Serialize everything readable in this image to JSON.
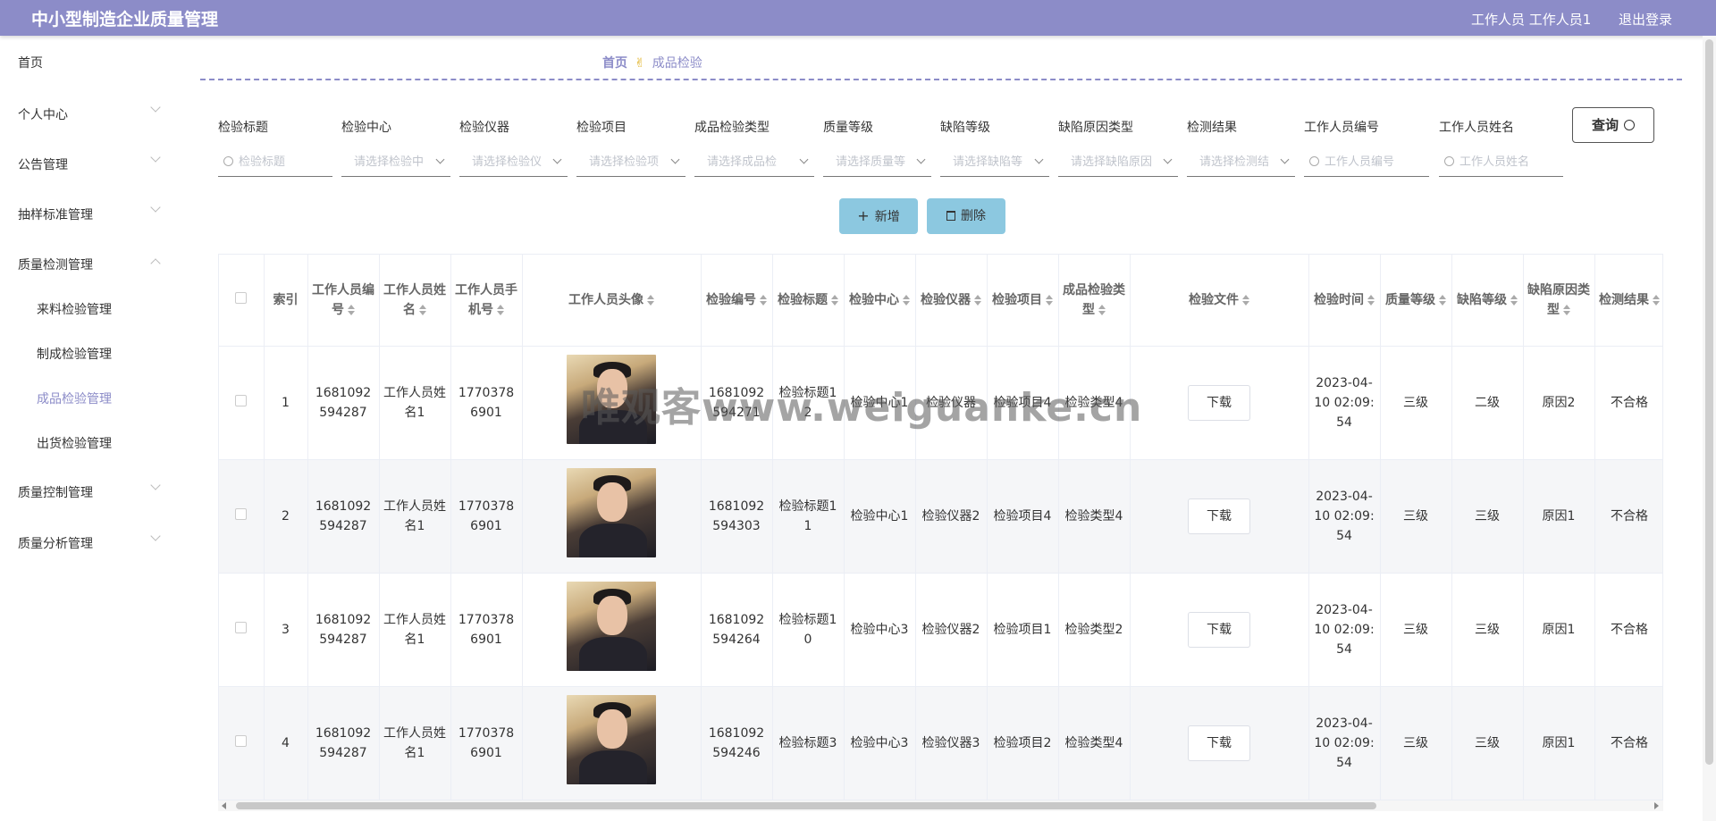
{
  "header": {
    "title": "中小型制造企业质量管理",
    "user": "工作人员 工作人员1",
    "logout": "退出登录"
  },
  "sidebar": {
    "items": [
      {
        "label": "首页"
      },
      {
        "label": "个人中心"
      },
      {
        "label": "公告管理"
      },
      {
        "label": "抽样标准管理"
      },
      {
        "label": "质量检测管理"
      },
      {
        "label": "来料检验管理"
      },
      {
        "label": "制成检验管理"
      },
      {
        "label": "成品检验管理"
      },
      {
        "label": "出货检验管理"
      },
      {
        "label": "质量控制管理"
      },
      {
        "label": "质量分析管理"
      }
    ]
  },
  "breadcrumb": {
    "home": "首页",
    "separator": "✌",
    "current": "成品检验"
  },
  "filters": [
    {
      "label": "检验标题",
      "placeholder": "检验标题"
    },
    {
      "label": "检验中心",
      "placeholder": "请选择检验中"
    },
    {
      "label": "检验仪器",
      "placeholder": "请选择检验仪"
    },
    {
      "label": "检验项目",
      "placeholder": "请选择检验项"
    },
    {
      "label": "成品检验类型",
      "placeholder": "请选择成品检"
    },
    {
      "label": "质量等级",
      "placeholder": "请选择质量等"
    },
    {
      "label": "缺陷等级",
      "placeholder": "请选择缺陷等"
    },
    {
      "label": "缺陷原因类型",
      "placeholder": "请选择缺陷原因"
    },
    {
      "label": "检测结果",
      "placeholder": "请选择检测结"
    },
    {
      "label": "工作人员编号",
      "placeholder": "工作人员编号"
    },
    {
      "label": "工作人员姓名",
      "placeholder": "工作人员姓名"
    }
  ],
  "actions": {
    "query": "查询",
    "add": "新增",
    "delete": "删除"
  },
  "table": {
    "headers": [
      "索引",
      "工作人员编号",
      "工作人员姓名",
      "工作人员手机号",
      "工作人员头像",
      "检验编号",
      "检验标题",
      "检验中心",
      "检验仪器",
      "检验项目",
      "成品检验类型",
      "检验文件",
      "检验时间",
      "质量等级",
      "缺陷等级",
      "缺陷原因类型",
      "检测结果"
    ],
    "download_label": "下载",
    "rows": [
      {
        "index": "1",
        "staff_no": "1681092594287",
        "staff_name": "工作人员姓名1",
        "phone": "17703786901",
        "check_no": "1681092594271",
        "title": "检验标题12",
        "center": "检验中心1",
        "instrument": "检验仪器",
        "item": "检验项目4",
        "type": "检验类型4",
        "time": "2023-04-10 02:09:54",
        "quality": "三级",
        "defect": "二级",
        "reason": "原因2",
        "result": "不合格"
      },
      {
        "index": "2",
        "staff_no": "1681092594287",
        "staff_name": "工作人员姓名1",
        "phone": "17703786901",
        "check_no": "1681092594303",
        "title": "检验标题11",
        "center": "检验中心1",
        "instrument": "检验仪器2",
        "item": "检验项目4",
        "type": "检验类型4",
        "time": "2023-04-10 02:09:54",
        "quality": "三级",
        "defect": "三级",
        "reason": "原因1",
        "result": "不合格"
      },
      {
        "index": "3",
        "staff_no": "1681092594287",
        "staff_name": "工作人员姓名1",
        "phone": "17703786901",
        "check_no": "1681092594264",
        "title": "检验标题10",
        "center": "检验中心3",
        "instrument": "检验仪器2",
        "item": "检验项目1",
        "type": "检验类型2",
        "time": "2023-04-10 02:09:54",
        "quality": "三级",
        "defect": "三级",
        "reason": "原因1",
        "result": "不合格"
      },
      {
        "index": "4",
        "staff_no": "1681092594287",
        "staff_name": "工作人员姓名1",
        "phone": "17703786901",
        "check_no": "1681092594246",
        "title": "检验标题3",
        "center": "检验中心3",
        "instrument": "检验仪器3",
        "item": "检验项目2",
        "type": "检验类型4",
        "time": "2023-04-10 02:09:54",
        "quality": "三级",
        "defect": "三级",
        "reason": "原因1",
        "result": "不合格"
      }
    ]
  },
  "watermark": "唯观客www.weiguanke.cn",
  "icons": {
    "menu_arrow": "chevron-icon",
    "search": "search-icon",
    "add": "plus-icon",
    "delete": "trash-icon",
    "sort": "sort-icon"
  },
  "colors": {
    "brand": "#8c8cc8",
    "button": "#8cc8e0"
  }
}
